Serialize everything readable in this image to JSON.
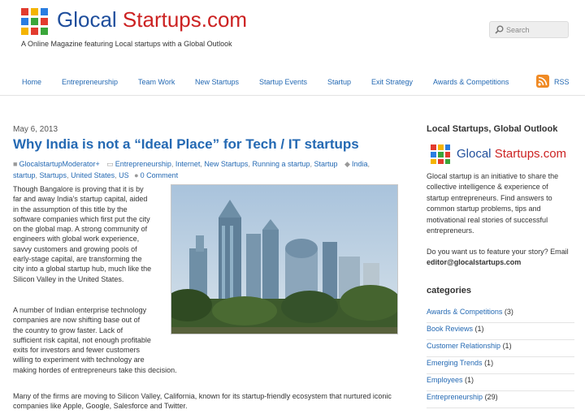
{
  "site": {
    "title_part1": "Glocal ",
    "title_part2": "Startups.com",
    "tagline": "A Online Magazine featuring Local startups with a Global Outlook",
    "colors": {
      "brand_blue": "#1f4e9c",
      "brand_red": "#cc2222",
      "link": "#2469b3",
      "rss_orange": "#f08a24"
    }
  },
  "search": {
    "placeholder": "Search",
    "icon": "search-icon"
  },
  "nav": {
    "items": [
      {
        "label": "Home"
      },
      {
        "label": "Entrepreneurship"
      },
      {
        "label": "Team Work"
      },
      {
        "label": "New Startups"
      },
      {
        "label": "Startup Events"
      },
      {
        "label": "Startup"
      },
      {
        "label": "Exit Strategy"
      },
      {
        "label": "Awards & Competitions"
      }
    ],
    "rss_label": "RSS",
    "rss_icon": "rss-icon"
  },
  "post": {
    "date": "May 6, 2013",
    "title": "Why India is not a “Ideal Place” for Tech / IT startups",
    "author": "GlocalstartupModerator+",
    "categories": [
      "Entrepreneurship",
      "Internet",
      "New Startups",
      "Running a startup",
      "Startup"
    ],
    "tags_first": "India",
    "tags": [
      "startup",
      "Startups",
      "United States",
      "US"
    ],
    "comments": "0 Comment",
    "paragraph1_lines": [
      "Though Bangalore is proving that it is by",
      "far and away India’s startup capital, aided",
      "in the assumption of this title by the",
      "software companies which first put the city",
      "on the global map. A strong community of",
      "engineers with global work experience,",
      "savvy customers and growing pools of",
      "early-stage capital, are transforming the",
      "city into a global startup hub, much like the",
      "Silicon Valley in the United States."
    ],
    "paragraph2_lines": [
      "A number of Indian enterprise technology",
      "companies are now shifting base out of",
      "the country to grow faster. Lack of",
      "sufficient risk capital, not enough profitable",
      "exits for investors and fewer customers",
      "willing to experiment with technology are",
      "making hordes of entrepreneurs take this decision."
    ],
    "paragraph3_lines": [
      "Many of the firms are moving to Silicon Valley, California, known for its startup-friendly ecosystem that nurtured iconic",
      "companies like Apple, Google, Salesforce and Twitter."
    ]
  },
  "sidebar": {
    "about_heading": "Local Startups, Global Outlook",
    "logo_part1": "Glocal ",
    "logo_part2": "Startups.com",
    "about_lines": [
      "Glocal startup is an initiative to share the",
      "collective intelligence & experience of",
      "startup entrepreneurs. Find answers to",
      "common startup problems, tips and",
      "motivational real stories of successful",
      "entrepreneurs."
    ],
    "feature_lines": [
      "Do you want us to feature your story? Email"
    ],
    "email": "editor@glocalstartups.com",
    "categories_heading": "categories",
    "categories": [
      {
        "name": "Awards & Competitions",
        "count": "(3)"
      },
      {
        "name": "Book Reviews",
        "count": "(1)"
      },
      {
        "name": "Customer Relationship",
        "count": "(1)"
      },
      {
        "name": "Emerging Trends",
        "count": "(1)"
      },
      {
        "name": "Employees",
        "count": "(1)"
      },
      {
        "name": "Entrepreneurship",
        "count": "(29)"
      }
    ]
  }
}
